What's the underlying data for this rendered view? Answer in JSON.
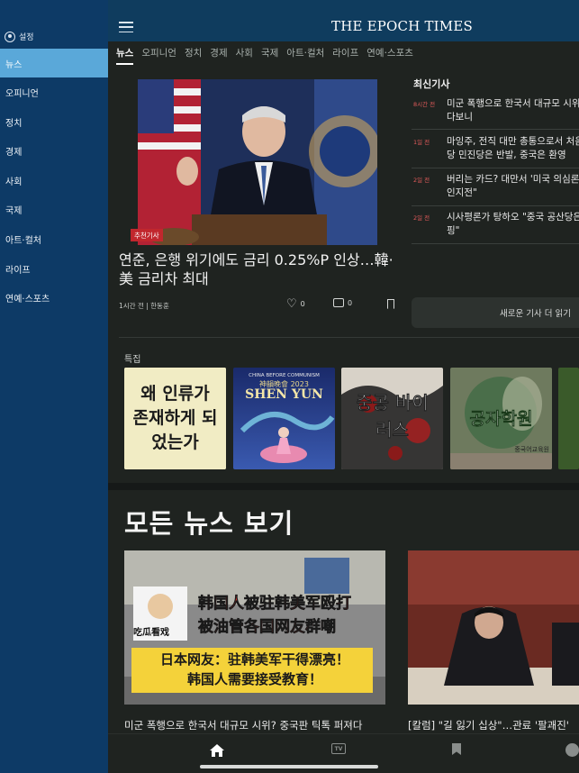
{
  "sidebar": {
    "settings_label": "설정",
    "items": [
      {
        "label": "뉴스",
        "active": true
      },
      {
        "label": "오피니언"
      },
      {
        "label": "정치"
      },
      {
        "label": "경제"
      },
      {
        "label": "사회"
      },
      {
        "label": "국제"
      },
      {
        "label": "아트·컬처"
      },
      {
        "label": "라이프"
      },
      {
        "label": "연예·스포츠"
      }
    ]
  },
  "header": {
    "logo": "THE EPOCH TIMES"
  },
  "tabs": [
    "뉴스",
    "오피니언",
    "정치",
    "경제",
    "사회",
    "국제",
    "아트·컬처",
    "라이프",
    "연예·스포츠"
  ],
  "hero": {
    "badge": "추천기사",
    "title": "연준, 은행 위기에도 금리 0.25%P 인상…韓·美 금리차 최대",
    "meta": "1시간 전 | 한동훈",
    "likes": "0",
    "comments": "0"
  },
  "latest": {
    "heading": "최신기사",
    "items": [
      {
        "time": "8시간 전",
        "text1": "미군 폭행으로 한국서 대규모 시위",
        "text2": "다보니"
      },
      {
        "time": "1일 전",
        "text1": "마잉주, 전직 대만 총통으로서 처음",
        "text2": "당 민진당은 반발, 중국은 환영"
      },
      {
        "time": "2일 전",
        "text1": "버리는 카드? 대만서 '미국 의심론",
        "text2": "인지전\""
      },
      {
        "time": "2일 전",
        "text1": "시사평론가 탕하오 \"중국 공산당은",
        "text2": "핑\""
      }
    ],
    "more_button": "새로운 기사 더 읽기"
  },
  "features": {
    "label": "특집",
    "cards": [
      {
        "text": "왜 인류가 존재하게 되었는가"
      },
      {
        "small": "CHINA BEFORE COMMUNISM",
        "chinese": "神韻晚會 2023",
        "title": "SHEN YUN"
      },
      {
        "text": "중공 바이러스"
      },
      {
        "text": "공자학원",
        "small": "중국어교육원"
      }
    ]
  },
  "all_news": {
    "title": "모든 뉴스 보기",
    "cards": [
      {
        "title": "미군 폭행으로 한국서 대규모 시위? 중국판 틱톡 퍼져다",
        "overlay": {
          "top": "吃瓜看戏",
          "line1": "韩国人被驻韩美军殴打",
          "line2": "被油管各国网友群嘲",
          "line3": "日本网友：驻韩美军干得漂亮！",
          "line4": "韩国人需要接受教育！"
        }
      },
      {
        "title": "[칼럼] \"길 잃기 십상\"…관료 '팔괘진'"
      }
    ]
  },
  "tabbar": {
    "tv_label": "TV"
  }
}
